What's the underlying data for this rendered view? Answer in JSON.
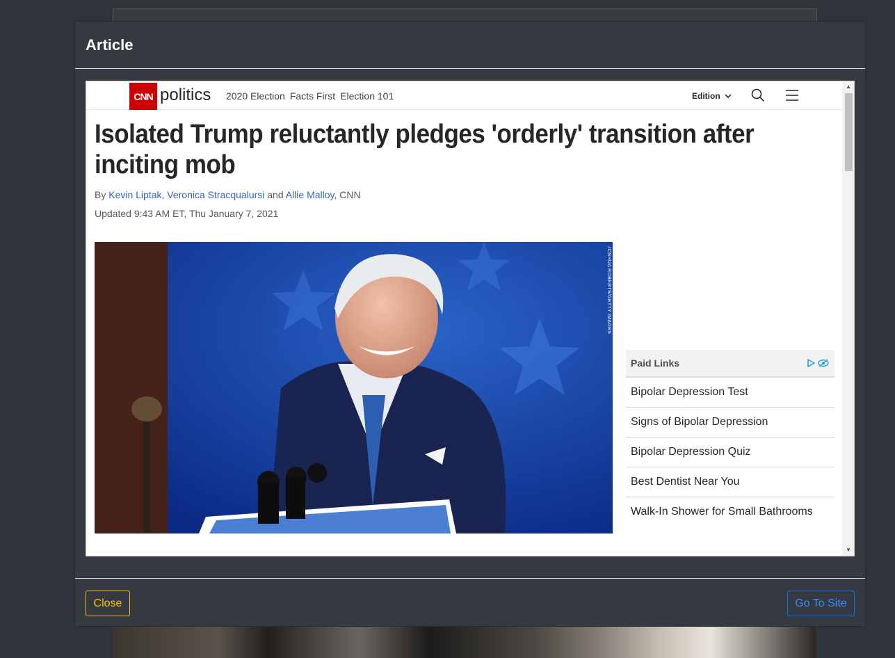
{
  "modal": {
    "title": "Article"
  },
  "site": {
    "logo": "CNN",
    "section": "politics",
    "nav": [
      "2020 Election",
      "Facts First",
      "Election 101"
    ],
    "edition_label": "Edition"
  },
  "article": {
    "headline": "Isolated Trump reluctantly pledges 'orderly' transition after inciting mob",
    "byline_prefix": "By",
    "authors": [
      "Kevin Liptak",
      "Veronica Stracqualursi",
      "Allie Malloy"
    ],
    "separator": ",",
    "and": "and",
    "byline_suffix": ", CNN",
    "updated": "Updated 9:43 AM ET, Thu January 7, 2021",
    "photo_credit": "JOSHUA ROBERTS/GETTY IMAGES"
  },
  "ad": {
    "title": "Paid Links",
    "links": [
      "Bipolar Depression Test",
      "Signs of Bipolar Depression",
      "Bipolar Depression Quiz",
      "Best Dentist Near You",
      "Walk-In Shower for Small Bathrooms"
    ]
  },
  "footer": {
    "close_label": "Close",
    "go_label": "Go To Site"
  },
  "colors": {
    "accent_close": "#ffc107",
    "accent_go": "#0d6efd",
    "cnn_red": "#cc0000"
  }
}
